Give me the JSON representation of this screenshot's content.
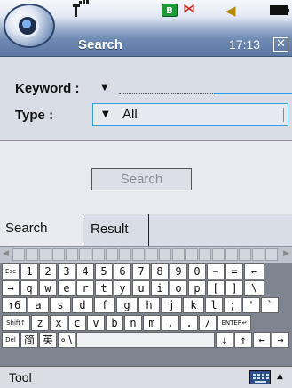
{
  "statusbar": {
    "title": "Search",
    "time": "17:13",
    "msg_badge": "B",
    "bt_glyph": "⋈"
  },
  "form": {
    "keyword_label": "Keyword :",
    "keyword_value": "",
    "type_label": "Type :",
    "type_value": "All"
  },
  "search_button": "Search",
  "tabs": [
    {
      "label": "Search",
      "active": true
    },
    {
      "label": "Result",
      "active": false
    }
  ],
  "keyboard": {
    "rows": [
      [
        "Esc",
        "1",
        "2",
        "3",
        "4",
        "5",
        "6",
        "7",
        "8",
        "9",
        "0",
        "−",
        "=",
        "←"
      ],
      [
        "→",
        "q",
        "w",
        "e",
        "r",
        "t",
        "y",
        "u",
        "i",
        "o",
        "p",
        "[",
        "]",
        "\\"
      ],
      [
        "↑6",
        "a",
        "s",
        "d",
        "f",
        "g",
        "h",
        "j",
        "k",
        "l",
        ";",
        "'",
        "`"
      ],
      [
        "Shift↑",
        "z",
        "x",
        "c",
        "v",
        "b",
        "n",
        "m",
        ",",
        ".",
        "/",
        "ENTER↵"
      ],
      [
        "Del",
        "简",
        "英",
        "∘∖",
        "",
        "↓",
        "↑",
        "←",
        "→"
      ]
    ]
  },
  "bottombar": {
    "menu": "Tool"
  },
  "icons": {
    "logo": "app-logo",
    "signal": "signal-icon",
    "message": "message-icon",
    "bluetooth": "bluetooth-icon",
    "speaker": "speaker-icon",
    "battery": "battery-icon",
    "close": "close-icon",
    "keyboard": "keyboard-icon"
  },
  "colors": {
    "accent": "#3a9de0",
    "titlebar": "#6f8ab3",
    "message_badge": "#1d9b36",
    "bluetooth": "#cc2a1f"
  }
}
